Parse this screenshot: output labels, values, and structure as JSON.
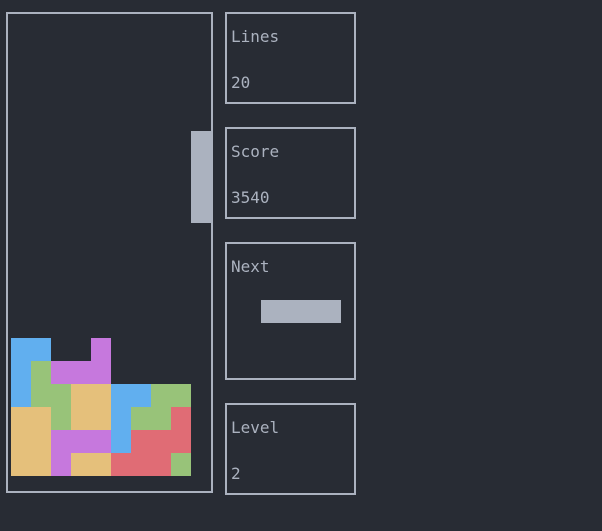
{
  "stats": {
    "lines_label": "Lines",
    "lines_value": "20",
    "score_label": "Score",
    "score_value": "3540",
    "next_label": "Next",
    "level_label": "Level",
    "level_value": "2"
  },
  "colors": {
    "background": "#282c34",
    "border": "#abb2bf",
    "active_piece": "#abb2bf",
    "blue": "#61afef",
    "green": "#98c379",
    "purple": "#c678dd",
    "yellow": "#e5c07b",
    "red": "#e06c75"
  },
  "board": {
    "columns": 10,
    "rows": 20,
    "active_piece": {
      "type": "I",
      "orientation": "vertical",
      "cells": [
        [
          9,
          5
        ],
        [
          9,
          6
        ],
        [
          9,
          7
        ],
        [
          9,
          8
        ]
      ]
    },
    "locked_cells": [
      {
        "col": 0,
        "row": 14,
        "color": "blue"
      },
      {
        "col": 1,
        "row": 14,
        "color": "blue"
      },
      {
        "col": 4,
        "row": 14,
        "color": "purple"
      },
      {
        "col": 0,
        "row": 15,
        "color": "blue"
      },
      {
        "col": 1,
        "row": 15,
        "color": "green"
      },
      {
        "col": 2,
        "row": 15,
        "color": "purple"
      },
      {
        "col": 3,
        "row": 15,
        "color": "purple"
      },
      {
        "col": 4,
        "row": 15,
        "color": "purple"
      },
      {
        "col": 0,
        "row": 16,
        "color": "blue"
      },
      {
        "col": 1,
        "row": 16,
        "color": "green"
      },
      {
        "col": 2,
        "row": 16,
        "color": "green"
      },
      {
        "col": 3,
        "row": 16,
        "color": "yellow"
      },
      {
        "col": 4,
        "row": 16,
        "color": "yellow"
      },
      {
        "col": 5,
        "row": 16,
        "color": "blue"
      },
      {
        "col": 6,
        "row": 16,
        "color": "blue"
      },
      {
        "col": 7,
        "row": 16,
        "color": "green"
      },
      {
        "col": 8,
        "row": 16,
        "color": "green"
      },
      {
        "col": 0,
        "row": 17,
        "color": "yellow"
      },
      {
        "col": 1,
        "row": 17,
        "color": "yellow"
      },
      {
        "col": 2,
        "row": 17,
        "color": "green"
      },
      {
        "col": 3,
        "row": 17,
        "color": "yellow"
      },
      {
        "col": 4,
        "row": 17,
        "color": "yellow"
      },
      {
        "col": 5,
        "row": 17,
        "color": "blue"
      },
      {
        "col": 6,
        "row": 17,
        "color": "green"
      },
      {
        "col": 7,
        "row": 17,
        "color": "green"
      },
      {
        "col": 8,
        "row": 17,
        "color": "red"
      },
      {
        "col": 0,
        "row": 18,
        "color": "yellow"
      },
      {
        "col": 1,
        "row": 18,
        "color": "yellow"
      },
      {
        "col": 2,
        "row": 18,
        "color": "purple"
      },
      {
        "col": 3,
        "row": 18,
        "color": "purple"
      },
      {
        "col": 4,
        "row": 18,
        "color": "purple"
      },
      {
        "col": 5,
        "row": 18,
        "color": "blue"
      },
      {
        "col": 6,
        "row": 18,
        "color": "red"
      },
      {
        "col": 7,
        "row": 18,
        "color": "red"
      },
      {
        "col": 8,
        "row": 18,
        "color": "red"
      },
      {
        "col": 0,
        "row": 19,
        "color": "yellow"
      },
      {
        "col": 1,
        "row": 19,
        "color": "yellow"
      },
      {
        "col": 2,
        "row": 19,
        "color": "purple"
      },
      {
        "col": 3,
        "row": 19,
        "color": "yellow"
      },
      {
        "col": 4,
        "row": 19,
        "color": "yellow"
      },
      {
        "col": 5,
        "row": 19,
        "color": "red"
      },
      {
        "col": 6,
        "row": 19,
        "color": "red"
      },
      {
        "col": 7,
        "row": 19,
        "color": "red"
      },
      {
        "col": 8,
        "row": 19,
        "color": "green"
      }
    ]
  },
  "next_piece": {
    "type": "I",
    "orientation": "horizontal",
    "cells": [
      [
        0,
        0
      ],
      [
        1,
        0
      ],
      [
        2,
        0
      ],
      [
        3,
        0
      ]
    ]
  }
}
